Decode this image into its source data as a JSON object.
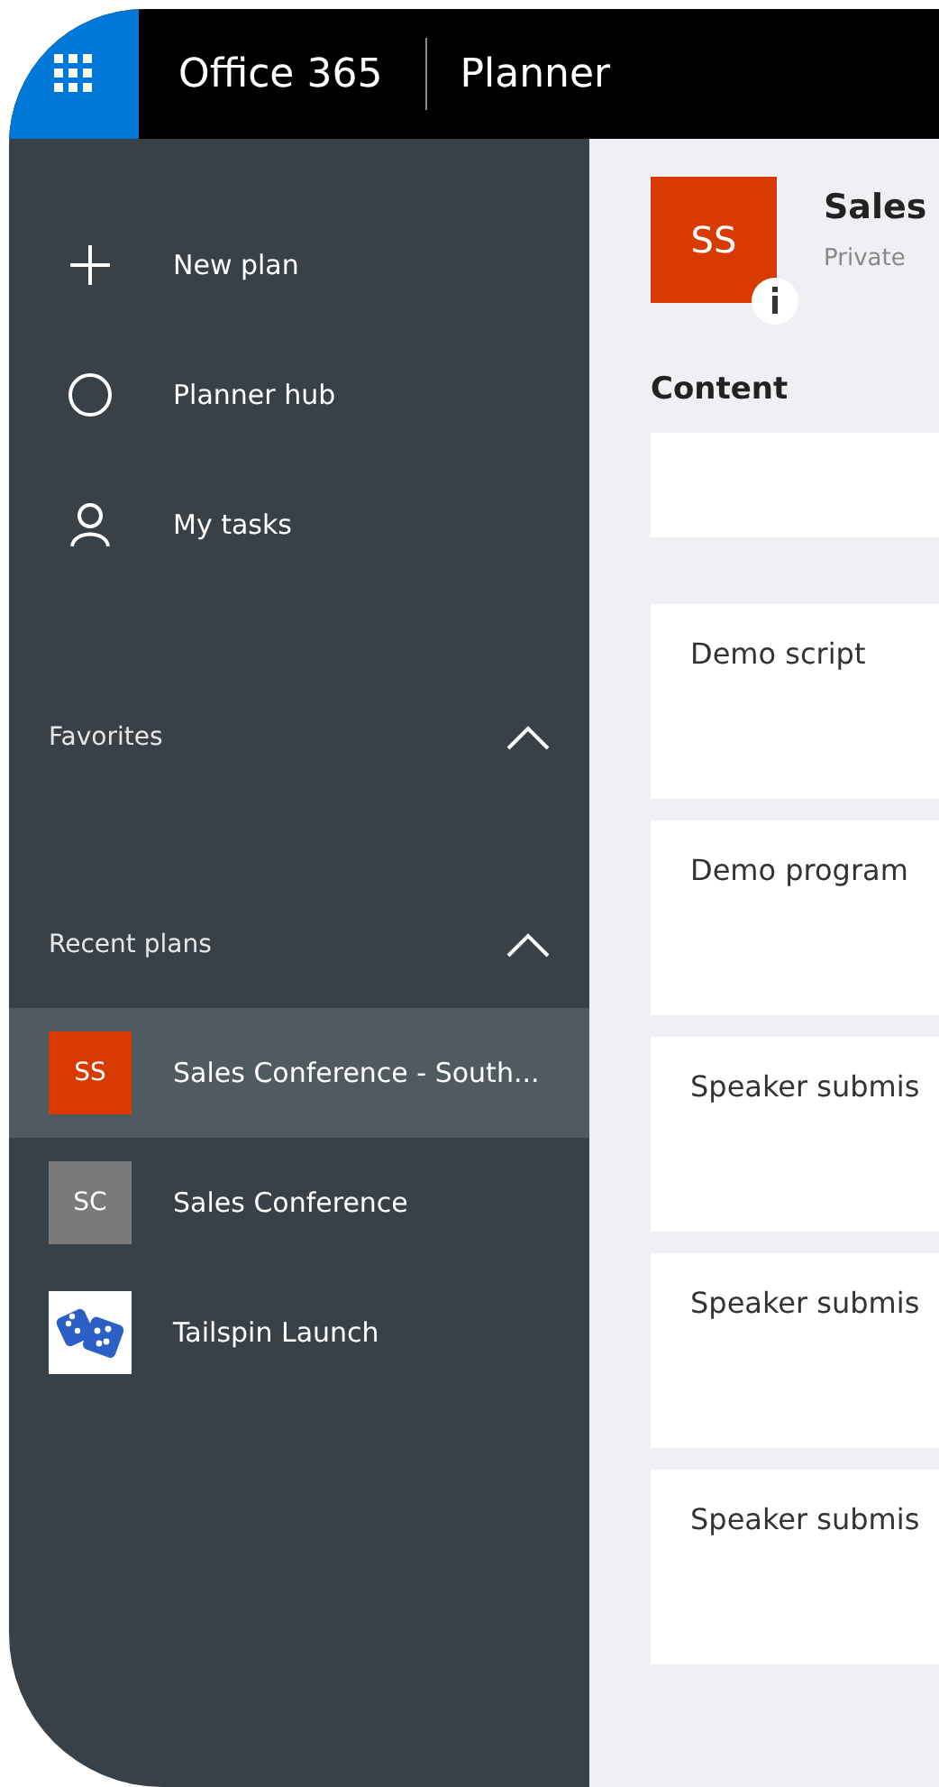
{
  "header": {
    "brand": "Office 365",
    "app": "Planner"
  },
  "nav": [
    {
      "kind": "add",
      "label": "New plan"
    },
    {
      "kind": "hub",
      "label": "Planner hub"
    },
    {
      "kind": "person",
      "label": "My tasks"
    }
  ],
  "favorites": {
    "title": "Favorites",
    "expanded": true
  },
  "recent": {
    "title": "Recent plans",
    "expanded": true,
    "plans": [
      {
        "kind": "initials",
        "initials": "SS",
        "color": "#d83b01",
        "label": "Sales Conference - South...",
        "selected": true
      },
      {
        "kind": "initials",
        "initials": "SC",
        "color": "#7a7a7a",
        "label": "Sales Conference",
        "selected": false
      },
      {
        "kind": "image",
        "label": "Tailspin Launch",
        "selected": false
      }
    ]
  },
  "plan": {
    "initials": "SS",
    "title": "Sales",
    "privacy": "Private"
  },
  "bucket": {
    "title": "Content",
    "tasks": [
      {
        "title": "Demo script"
      },
      {
        "title": "Demo program"
      },
      {
        "title": "Speaker submis"
      },
      {
        "title": "Speaker submis"
      },
      {
        "title": "Speaker submis"
      }
    ]
  }
}
